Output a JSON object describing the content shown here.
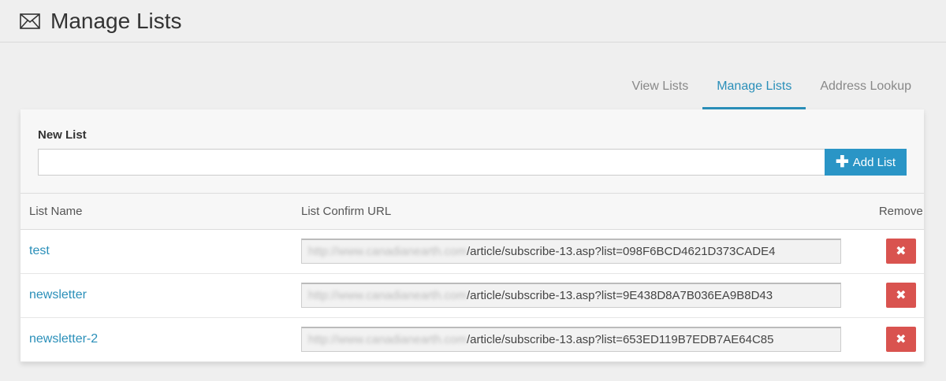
{
  "header": {
    "title": "Manage Lists",
    "icon": "envelope-icon"
  },
  "tabs": [
    {
      "label": "View Lists",
      "active": false
    },
    {
      "label": "Manage Lists",
      "active": true
    },
    {
      "label": "Address Lookup",
      "active": false
    }
  ],
  "new_list": {
    "label": "New List",
    "input_value": "",
    "add_button_label": "Add List",
    "add_icon": "plus-icon"
  },
  "table": {
    "headers": {
      "name": "List Name",
      "url": "List Confirm URL",
      "remove": "Remove"
    },
    "rows": [
      {
        "name": "test",
        "url_prefix": "http://www.canadianearth.com",
        "url_path": "/article/subscribe-13.asp?list=098F6BCD4621D373CADE4"
      },
      {
        "name": "newsletter",
        "url_prefix": "http://www.canadianearth.com",
        "url_path": "/article/subscribe-13.asp?list=9E438D8A7B036EA9B8D43"
      },
      {
        "name": "newsletter-2",
        "url_prefix": "http://www.canadianearth.com",
        "url_path": "/article/subscribe-13.asp?list=653ED119B7EDB7AE64C85"
      }
    ],
    "remove_icon": "close-icon"
  },
  "colors": {
    "accent": "#2a95c6",
    "danger": "#d9534f"
  }
}
